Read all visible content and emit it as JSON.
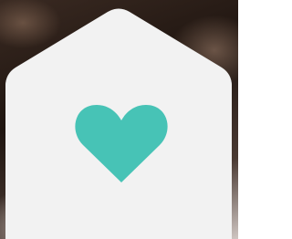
{
  "card": {
    "fill": "#f2f2f2",
    "shadow": "#d9d9d9"
  },
  "icon": {
    "name": "heart-icon",
    "color": "#47c3b6"
  },
  "background": {
    "description_color": "#2a1f1a"
  }
}
